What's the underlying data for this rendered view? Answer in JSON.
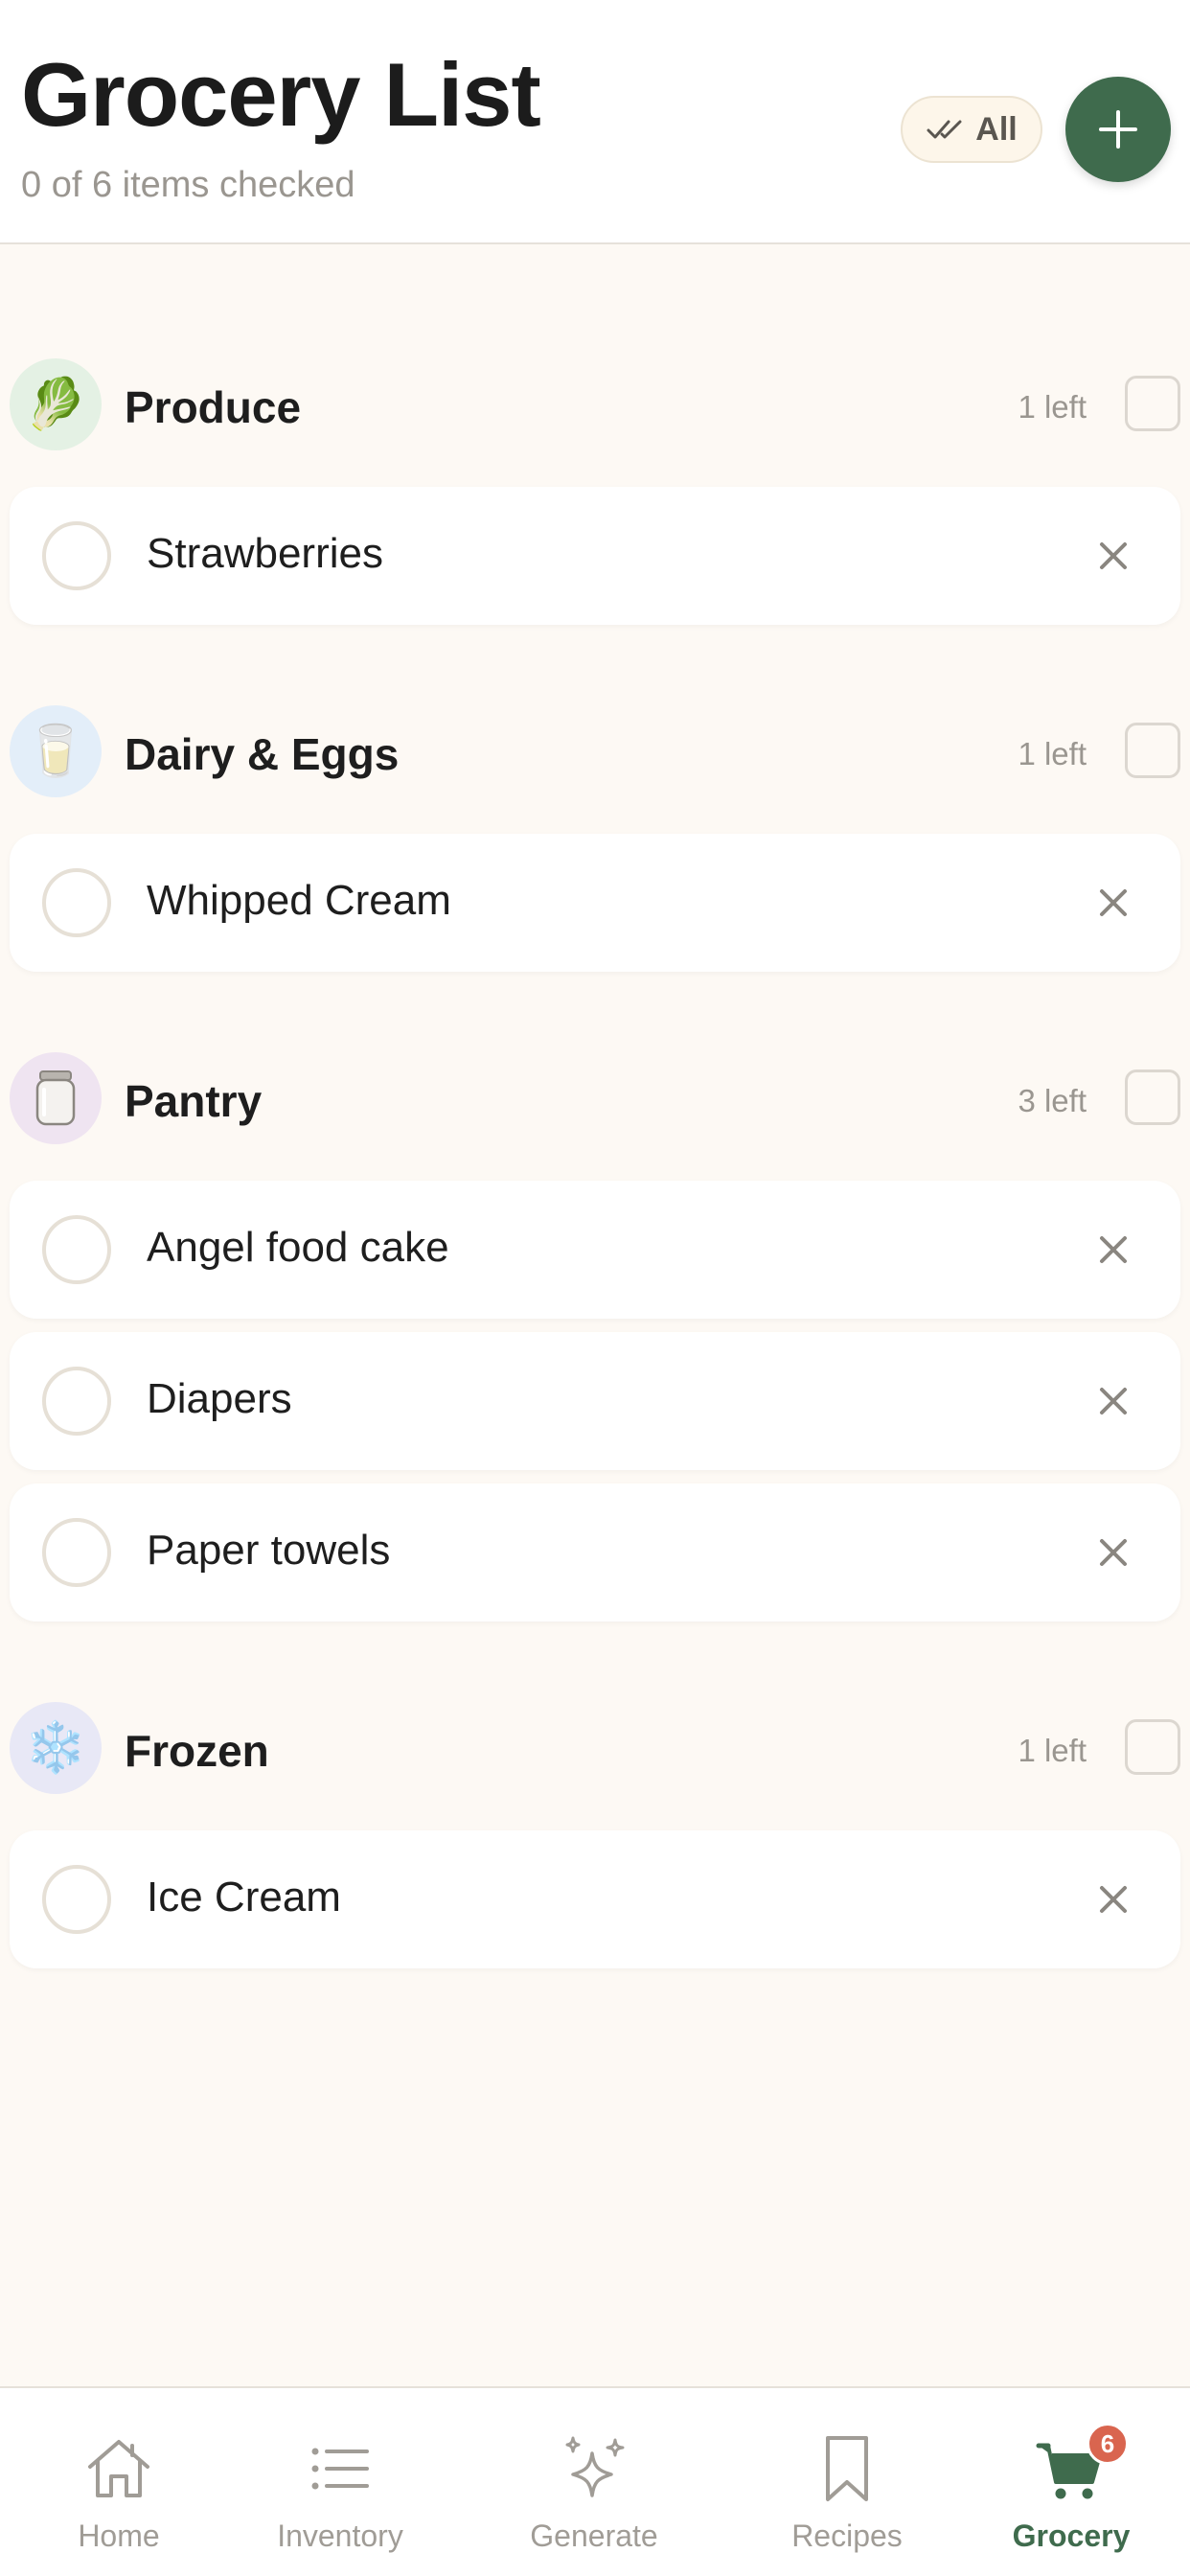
{
  "header": {
    "title": "Grocery List",
    "subtitle": "0 of 6 items checked",
    "all_button_label": "All"
  },
  "colors": {
    "accent": "#3f6b4d",
    "background": "#fdf9f4",
    "badge": "#d9654f"
  },
  "categories": [
    {
      "name": "Produce",
      "icon": "lettuce-icon",
      "emoji": "🥬",
      "left": "1 left",
      "items": [
        {
          "name": "Strawberries"
        }
      ]
    },
    {
      "name": "Dairy & Eggs",
      "icon": "milk-glass-icon",
      "emoji": "🥛",
      "left": "1 left",
      "items": [
        {
          "name": "Whipped Cream"
        }
      ]
    },
    {
      "name": "Pantry",
      "icon": "jar-icon",
      "emoji": "🫙",
      "left": "3 left",
      "items": [
        {
          "name": "Angel food cake"
        },
        {
          "name": "Diapers"
        },
        {
          "name": "Paper towels"
        }
      ]
    },
    {
      "name": "Frozen",
      "icon": "snowflake-icon",
      "emoji": "❄️",
      "left": "1 left",
      "items": [
        {
          "name": "Ice Cream"
        }
      ]
    }
  ],
  "tabbar": {
    "tabs": [
      {
        "label": "Home",
        "icon": "home-icon"
      },
      {
        "label": "Inventory",
        "icon": "list-icon"
      },
      {
        "label": "Generate",
        "icon": "sparkles-icon"
      },
      {
        "label": "Recipes",
        "icon": "bookmark-icon"
      },
      {
        "label": "Grocery",
        "icon": "cart-icon",
        "active": true,
        "badge": "6"
      }
    ]
  }
}
